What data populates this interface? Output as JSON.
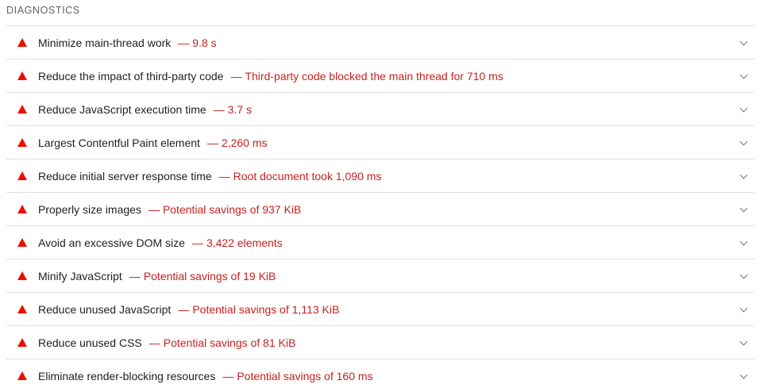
{
  "section": {
    "title": "DIAGNOSTICS"
  },
  "audits": [
    {
      "title": "Minimize main-thread work",
      "separator": "—",
      "value": "9.8 s"
    },
    {
      "title": "Reduce the impact of third-party code",
      "separator": "—",
      "value": "Third-party code blocked the main thread for 710 ms"
    },
    {
      "title": "Reduce JavaScript execution time",
      "separator": "—",
      "value": "3.7 s"
    },
    {
      "title": "Largest Contentful Paint element",
      "separator": "—",
      "value": "2,260 ms"
    },
    {
      "title": "Reduce initial server response time",
      "separator": "—",
      "value": "Root document took 1,090 ms"
    },
    {
      "title": "Properly size images",
      "separator": "—",
      "value": "Potential savings of 937 KiB"
    },
    {
      "title": "Avoid an excessive DOM size",
      "separator": "—",
      "value": "3,422 elements"
    },
    {
      "title": "Minify JavaScript",
      "separator": "—",
      "value": "Potential savings of 19 KiB"
    },
    {
      "title": "Reduce unused JavaScript",
      "separator": "—",
      "value": "Potential savings of 1,113 KiB"
    },
    {
      "title": "Reduce unused CSS",
      "separator": "—",
      "value": "Potential savings of 81 KiB"
    },
    {
      "title": "Eliminate render-blocking resources",
      "separator": "—",
      "value": "Potential savings of 160 ms"
    }
  ],
  "icons": {
    "status": "warning-triangle-icon",
    "expand": "chevron-down-icon"
  },
  "colors": {
    "fail": "#eb0f00",
    "value_text": "#c5221f",
    "divider": "#e0e0e0"
  }
}
